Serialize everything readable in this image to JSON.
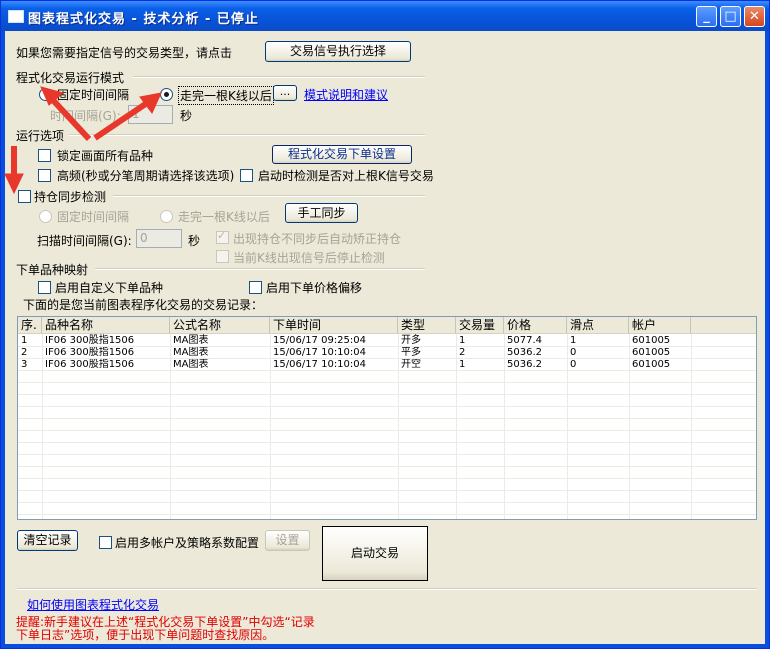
{
  "window": {
    "title": "图表程式化交易 - 技术分析 - 已停止",
    "controls": {
      "min": "_",
      "max": "□",
      "close": "✕"
    }
  },
  "signal": {
    "prompt": "如果您需要指定信号的交易类型，请点击",
    "button": "交易信号执行选择"
  },
  "mode": {
    "header": "程式化交易运行模式",
    "fixed_interval": "固定时间间隔",
    "after_bar": "走完一根K线以后",
    "more_button": "...",
    "help_link": "模式说明和建议",
    "interval_label": "时间间隔(G):",
    "interval_value": "1",
    "interval_unit": "秒"
  },
  "options": {
    "header": "运行选项",
    "lock_all": "锁定画面所有品种",
    "order_settings_button": "程式化交易下单设置",
    "high_freq": "高频(秒或分笔周期请选择该选项)",
    "check_last_bar": "启动时检测是否对上根K信号交易"
  },
  "sync": {
    "header": "持仓同步检测",
    "fixed_interval": "固定时间间隔",
    "after_bar": "走完一根K线以后",
    "manual_button": "手工同步",
    "scan_label": "扫描时间间隔(G):",
    "scan_value": "0",
    "scan_unit": "秒",
    "auto_fix": "出现持仓不同步后自动矫正持仓",
    "stop_detect": "当前K线出现信号后停止检测"
  },
  "mapping": {
    "header": "下单品种映射",
    "custom_symbol": "启用自定义下单品种",
    "price_offset": "启用下单价格偏移",
    "records_caption": "下面的是您当前图表程序化交易的交易记录："
  },
  "table": {
    "columns": [
      "序.",
      "品种名称",
      "公式名称",
      "下单时间",
      "类型",
      "交易量",
      "价格",
      "滑点",
      "帐户"
    ],
    "rows": [
      [
        "1",
        "IF06 300股指1506",
        "MA图表",
        "15/06/17 09:25:04",
        "开多",
        "1",
        "5077.4",
        "1",
        "601005"
      ],
      [
        "2",
        "IF06 300股指1506",
        "MA图表",
        "15/06/17 10:10:04",
        "平多",
        "2",
        "5036.2",
        "0",
        "601005"
      ],
      [
        "3",
        "IF06 300股指1506",
        "MA图表",
        "15/06/17 10:10:04",
        "开空",
        "1",
        "5036.2",
        "0",
        "601005"
      ]
    ]
  },
  "bottom": {
    "clear_button": "清空记录",
    "multi_account": "启用多帐户及策略系数配置",
    "settings_button": "设置",
    "start_button": "启动交易",
    "howto_link": "如何使用图表程式化交易",
    "tip_line1": "提醒:新手建议在上述“程式化交易下单设置”中勾选“记录",
    "tip_line2": "下单日志”选项，便于出现下单问题时查找原因。"
  },
  "colors": {
    "title_bar": "#0a5fe8",
    "dialog_bg": "#ece9d8",
    "annotation_arrow": "#e8372b",
    "link": "#0000ff",
    "warning_text": "#e00000"
  }
}
